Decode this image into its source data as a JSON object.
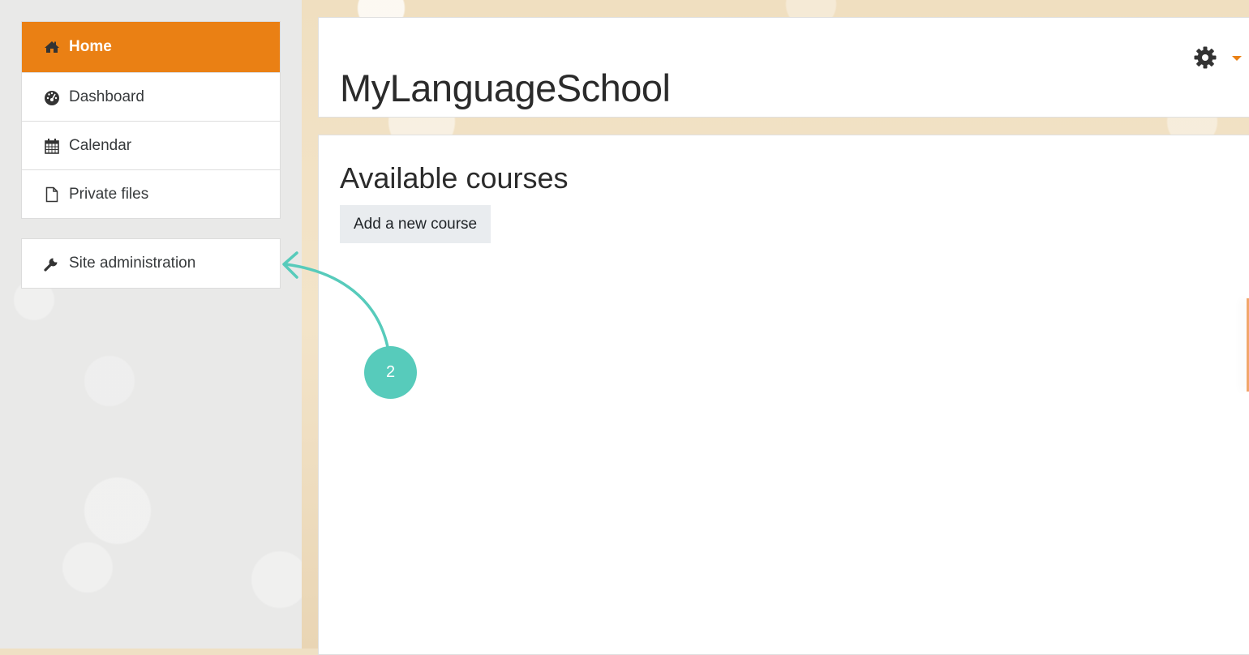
{
  "sidebar": {
    "primary_nav": [
      {
        "label": "Home",
        "icon": "home-icon",
        "active": true
      },
      {
        "label": "Dashboard",
        "icon": "dashboard-icon",
        "active": false
      },
      {
        "label": "Calendar",
        "icon": "calendar-icon",
        "active": false
      },
      {
        "label": "Private files",
        "icon": "file-icon",
        "active": false
      }
    ],
    "secondary_nav": [
      {
        "label": "Site administration",
        "icon": "wrench-icon"
      }
    ]
  },
  "header": {
    "site_title": "MyLanguageSchool",
    "settings_icon": "gear-icon",
    "menu_caret": "caret-down-icon"
  },
  "main": {
    "section_title": "Available courses",
    "add_course_label": "Add a new course"
  },
  "annotation": {
    "step_number": "2",
    "color": "#57cbbb"
  },
  "colors": {
    "accent": "#ea8014"
  }
}
